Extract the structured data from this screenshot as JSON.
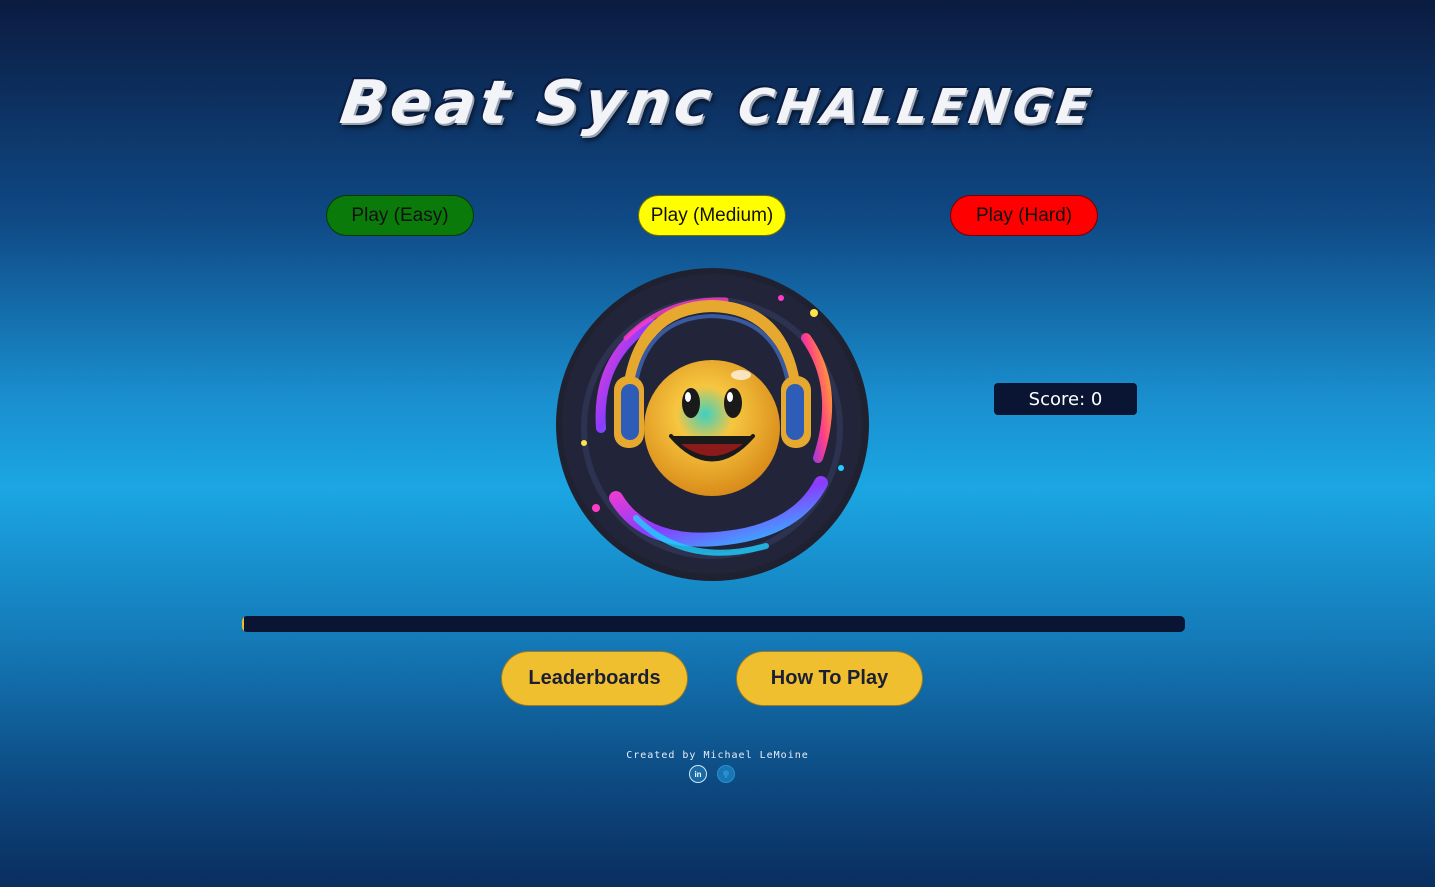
{
  "header": {
    "title_part1": "Beat Sync ",
    "title_part2": "CHALLENGE"
  },
  "difficulty": {
    "easy_label": "Play (Easy)",
    "medium_label": "Play (Medium)",
    "hard_label": "Play (Hard)",
    "easy_color": "#0a7a0a",
    "medium_color": "#ffff00",
    "hard_color": "#ff0000"
  },
  "logo": {
    "icon": "smiley-headphones-icon"
  },
  "score": {
    "label": "Score: 0"
  },
  "progress": {
    "fraction": 0.002
  },
  "menu": {
    "leaderboards_label": "Leaderboards",
    "how_to_play_label": "How To Play"
  },
  "footer": {
    "credit": "Created by Michael LeMoine",
    "linkedin_icon": "linkedin-icon",
    "linkedin_text": "in",
    "github_icon": "github-icon"
  },
  "colors": {
    "accent": "#f0bf2f",
    "dark": "#0a1533"
  }
}
